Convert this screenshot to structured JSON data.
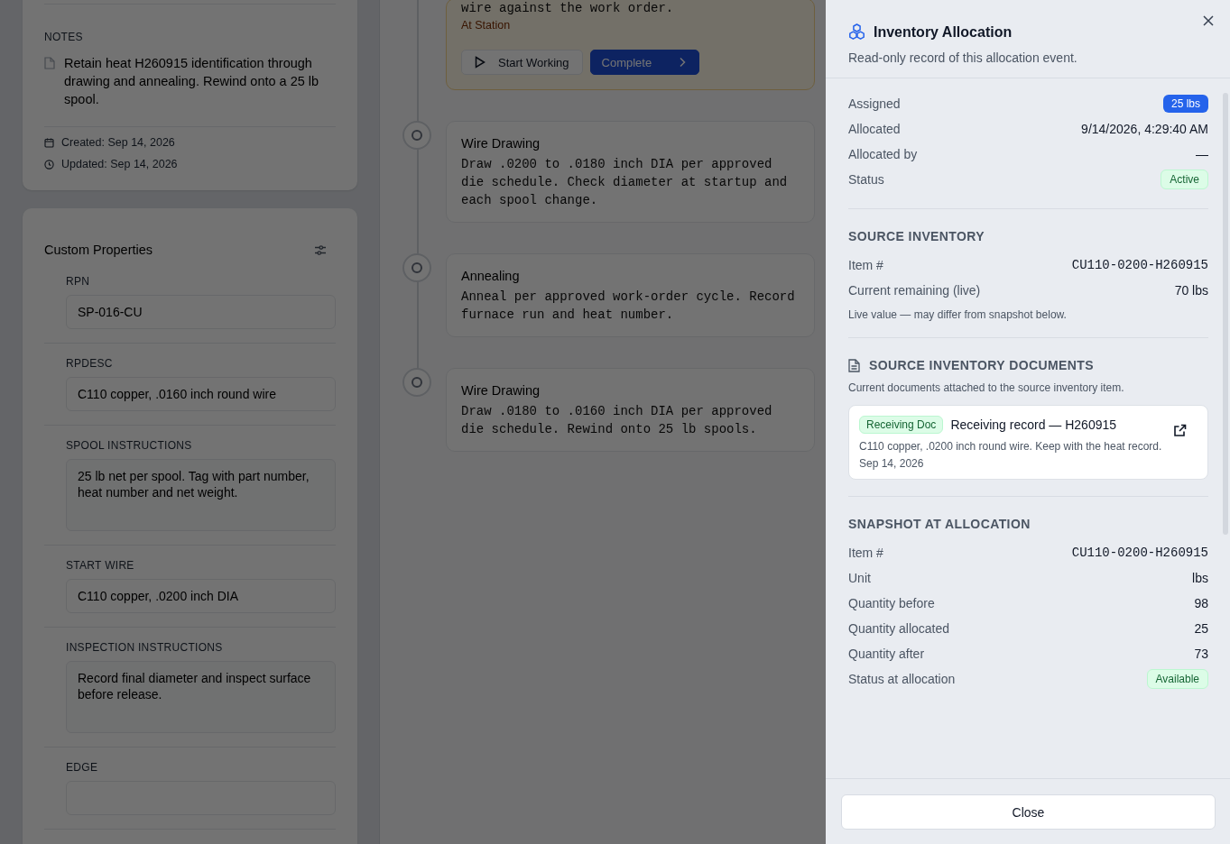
{
  "background": {
    "notes": {
      "label": "NOTES",
      "text": "Retain heat H260915 identification through drawing and annealing. Rewind onto a 25 lb spool.",
      "created": "Created: Sep 14, 2026",
      "updated": "Updated: Sep 14, 2026"
    },
    "custom_properties": {
      "title": "Custom Properties",
      "fields": [
        {
          "label": "RPN",
          "kind": "input",
          "value": "SP-016-CU"
        },
        {
          "label": "RPDESC",
          "kind": "input",
          "value": "C110 copper, .0160 inch round wire"
        },
        {
          "label": "SPOOL INSTRUCTIONS",
          "kind": "textarea",
          "value": "25 lb net per spool. Tag with part number, heat number and net weight."
        },
        {
          "label": "START WIRE",
          "kind": "input",
          "value": "C110 copper, .0200 inch DIA"
        },
        {
          "label": "INSPECTION INSTRUCTIONS",
          "kind": "textarea",
          "value": "Record final diameter and inspect surface before release."
        },
        {
          "label": "EDGE",
          "kind": "input"
        }
      ]
    },
    "steps": [
      {
        "current": true,
        "description": "wire against the work order.",
        "status": "At Station",
        "actions": [
          "Start Working",
          "Complete"
        ]
      },
      {
        "current": false,
        "title": "Wire Drawing",
        "description": "Draw .0200 to .0180 inch DIA per approved die schedule. Check diameter at startup and each spool change."
      },
      {
        "current": false,
        "title": "Annealing",
        "description": "Anneal per approved work-order cycle. Record furnace run and heat number."
      },
      {
        "current": false,
        "title": "Wire Drawing",
        "description": "Draw .0180 to .0160 inch DIA per approved die schedule. Rewind onto 25 lb spools."
      }
    ]
  },
  "drawer": {
    "title": "Inventory Allocation",
    "subtitle": "Read-only record of this allocation event.",
    "summary": [
      {
        "label": "Assigned",
        "value": "25 lbs",
        "kind": "count"
      },
      {
        "label": "Allocated",
        "value": "9/14/2026, 4:29:40 AM",
        "kind": "text"
      },
      {
        "label": "Allocated by",
        "value": "—",
        "kind": "text"
      },
      {
        "label": "Status",
        "value": "Active",
        "kind": "status"
      }
    ],
    "source_inventory": {
      "heading": "SOURCE INVENTORY",
      "rows": [
        {
          "label": "Item #",
          "value": "CU110-0200-H260915",
          "kind": "mono"
        },
        {
          "label": "Current remaining (live)",
          "value": "70 lbs",
          "kind": "text"
        }
      ],
      "note": "Live value — may differ from snapshot below."
    },
    "documents": {
      "heading": "SOURCE INVENTORY DOCUMENTS",
      "description": "Current documents attached to the source inventory item.",
      "items": [
        {
          "tag": "Receiving Doc",
          "title": "Receiving record — H260915",
          "description": "C110 copper, .0200 inch round wire. Keep with the heat record.",
          "date": "Sep 14, 2026"
        }
      ]
    },
    "snapshot": {
      "heading": "SNAPSHOT AT ALLOCATION",
      "rows": [
        {
          "label": "Item #",
          "value": "CU110-0200-H260915",
          "kind": "mono"
        },
        {
          "label": "Unit",
          "value": "lbs",
          "kind": "text"
        },
        {
          "label": "Quantity before",
          "value": "98",
          "kind": "text"
        },
        {
          "label": "Quantity allocated",
          "value": "25",
          "kind": "text"
        },
        {
          "label": "Quantity after",
          "value": "73",
          "kind": "text"
        },
        {
          "label": "Status at allocation",
          "value": "Available",
          "kind": "status"
        }
      ]
    },
    "close_button": "Close"
  }
}
